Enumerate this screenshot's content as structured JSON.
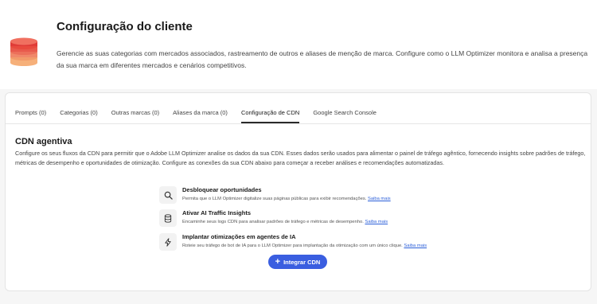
{
  "header": {
    "title": "Configuração do cliente",
    "description": "Gerencie as suas categorias com mercados associados, rastreamento de outros e aliases de menção de marca. Configure como o LLM Optimizer monitora e analisa a presença da sua marca em diferentes mercados e cenários competitivos."
  },
  "tabs": [
    {
      "label": "Prompts (0)"
    },
    {
      "label": "Categorias (0)"
    },
    {
      "label": "Outras marcas (0)"
    },
    {
      "label": "Aliases da marca (0)"
    },
    {
      "label": "Configuração de CDN",
      "active": true
    },
    {
      "label": "Google Search Console"
    }
  ],
  "section": {
    "title": "CDN agentiva",
    "description": "Configure os seus fluxos da CDN para permitir que o Adobe LLM Optimizer analise os dados da sua CDN. Esses dados serão usados para alimentar o painel de tráfego agêntico, fornecendo insights sobre padrões de tráfego, métricas de desempenho e oportunidades de otimização. Configure as conexões da sua CDN abaixo para começar a receber análises e recomendações automatizadas."
  },
  "features": [
    {
      "icon": "search-icon",
      "title": "Desbloquear oportunidades",
      "description": "Permita que o LLM Optimizer digitalize suas páginas públicas para exibir recomendações.",
      "link": "Saiba mais"
    },
    {
      "icon": "database-icon",
      "title": "Ativar AI Traffic Insights",
      "description": "Encaminhe seus logs CDN para analisar padrões de tráfego e métricas de desempenho.",
      "link": "Saiba mais"
    },
    {
      "icon": "lightning-icon",
      "title": "Implantar otimizações em agentes de IA",
      "description": "Roteie seu tráfego de bot de IA para o LLM Optimizer para implantação da otimização com um único clique.",
      "link": "Saiba mais"
    }
  ],
  "cta": {
    "label": "Integrar CDN",
    "icon": "plus-icon"
  },
  "colors": {
    "accent": "#3a5ee0",
    "link": "#2b5fd9",
    "logo_red": "#e8473c",
    "logo_orange": "#f4a259"
  }
}
